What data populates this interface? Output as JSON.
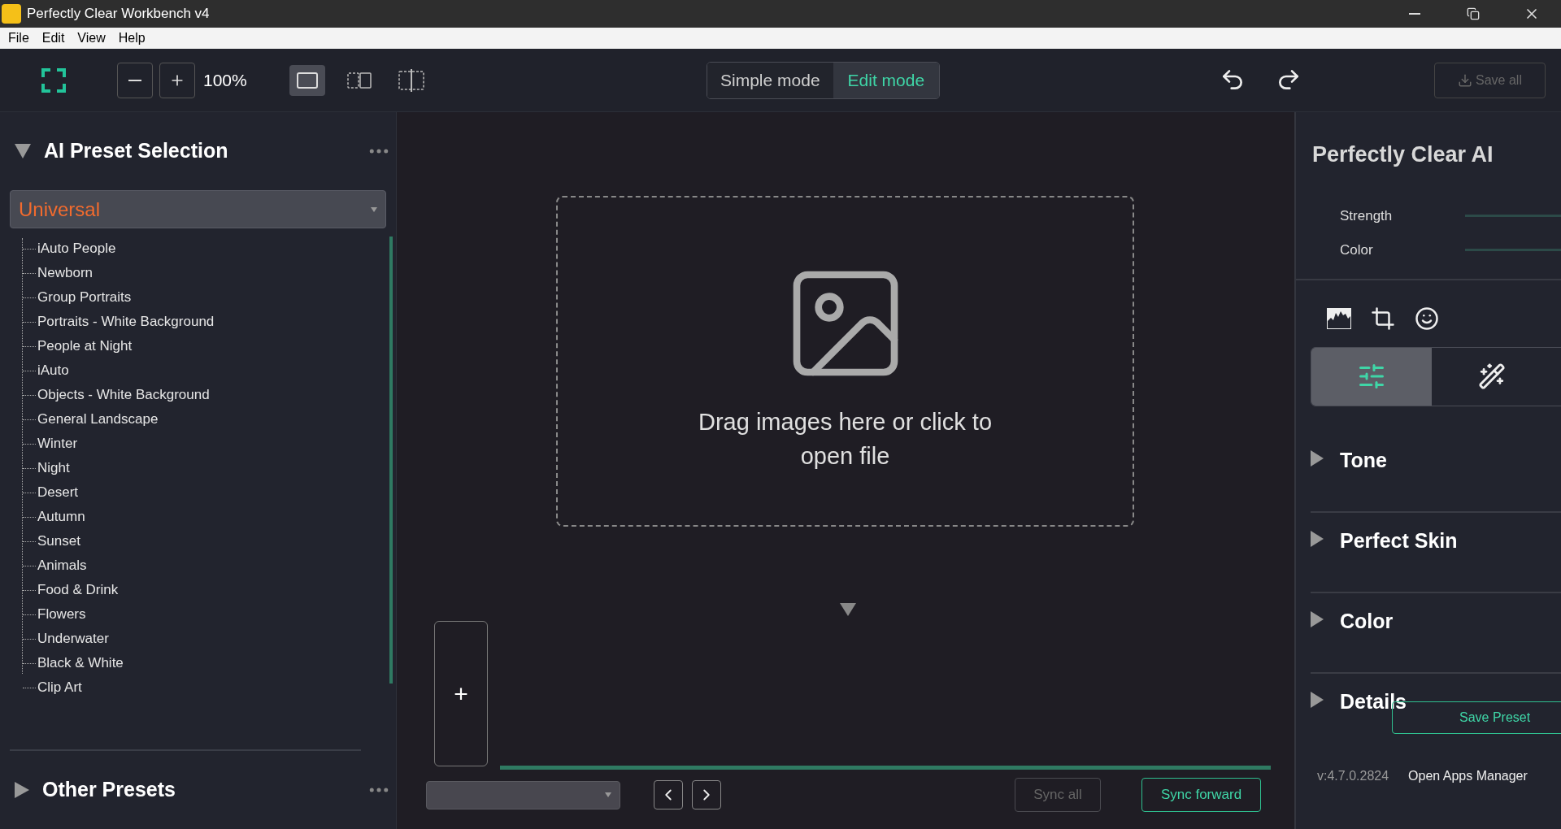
{
  "window": {
    "title": "Perfectly Clear Workbench v4"
  },
  "menu": [
    "File",
    "Edit",
    "View",
    "Help"
  ],
  "toolbar": {
    "zoom": "100%",
    "view_modes": [
      {
        "kind": "single",
        "selected": true
      },
      {
        "kind": "split",
        "selected": false
      },
      {
        "kind": "compare",
        "selected": false
      }
    ],
    "modes": [
      {
        "label": "Simple mode",
        "selected": false
      },
      {
        "label": "Edit mode",
        "selected": true
      }
    ],
    "save_all": {
      "label": "Save all",
      "disabled": true
    }
  },
  "left_panel": {
    "title": "AI Preset Selection",
    "expanded": true,
    "dropdown": "Universal",
    "presets": [
      "iAuto People",
      "Newborn",
      "Group Portraits",
      "Portraits - White Background",
      "People at Night",
      "iAuto",
      "Objects - White Background",
      "General Landscape",
      "Winter",
      "Night",
      "Desert",
      "Autumn",
      "Sunset",
      "Animals",
      "Food & Drink",
      "Flowers",
      "Underwater",
      "Black & White",
      "Clip Art"
    ],
    "other": {
      "title": "Other Presets",
      "expanded": false
    }
  },
  "canvas": {
    "drop_text": "Drag images here or click to open file",
    "add_tile": "+",
    "sync_all": {
      "label": "Sync all",
      "disabled": true
    },
    "sync_forward": {
      "label": "Sync forward",
      "disabled": false
    }
  },
  "right_panel": {
    "title": "Perfectly Clear AI",
    "sliders": [
      "Strength",
      "Color"
    ],
    "tool_tabs": [
      {
        "kind": "adjust",
        "selected": true
      },
      {
        "kind": "magic",
        "selected": false
      }
    ],
    "sections": [
      {
        "title": "Tone",
        "expanded": false
      },
      {
        "title": "Perfect Skin",
        "expanded": false
      },
      {
        "title": "Color",
        "expanded": false
      },
      {
        "title": "Details",
        "expanded": false
      }
    ],
    "save_preset": "Save Preset",
    "version": "v:4.7.0.2824",
    "apps_manager": "Open Apps Manager"
  }
}
